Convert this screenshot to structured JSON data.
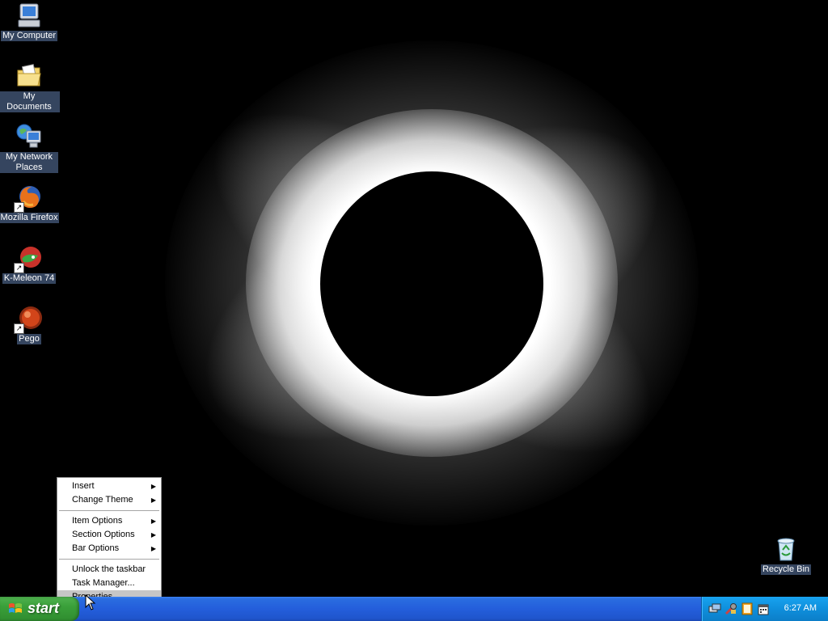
{
  "desktop": {
    "icons": [
      {
        "label": "My Computer",
        "icon": "computer-icon"
      },
      {
        "label": "My Documents",
        "icon": "documents-folder-icon"
      },
      {
        "label": "My Network Places",
        "icon": "network-places-icon"
      },
      {
        "label": "Mozilla Firefox",
        "icon": "firefox-icon"
      },
      {
        "label": "K-Meleon 74",
        "icon": "k-meleon-icon"
      },
      {
        "label": "Pego",
        "icon": "pego-icon"
      },
      {
        "label": "Recycle Bin",
        "icon": "recycle-bin-icon"
      }
    ]
  },
  "context_menu": {
    "items": [
      {
        "label": "Insert",
        "submenu": true
      },
      {
        "label": "Change Theme",
        "submenu": true
      },
      {
        "label": "Item Options",
        "submenu": true
      },
      {
        "label": "Section Options",
        "submenu": true
      },
      {
        "label": "Bar Options",
        "submenu": true
      },
      {
        "label": "Unlock the taskbar",
        "submenu": false
      },
      {
        "label": "Task Manager...",
        "submenu": false
      },
      {
        "label": "Properties",
        "submenu": false,
        "highlighted": true
      }
    ]
  },
  "taskbar": {
    "start_label": "start",
    "clock": "6:27 AM",
    "tray_icons": [
      "network-icon",
      "tools-icon",
      "notes-icon",
      "calendar-icon"
    ]
  },
  "colors": {
    "taskbar_blue": "#245edb",
    "start_green": "#3aa03a",
    "tray_blue": "#0f8fdc",
    "menu_highlight": "#c6c6c6"
  }
}
